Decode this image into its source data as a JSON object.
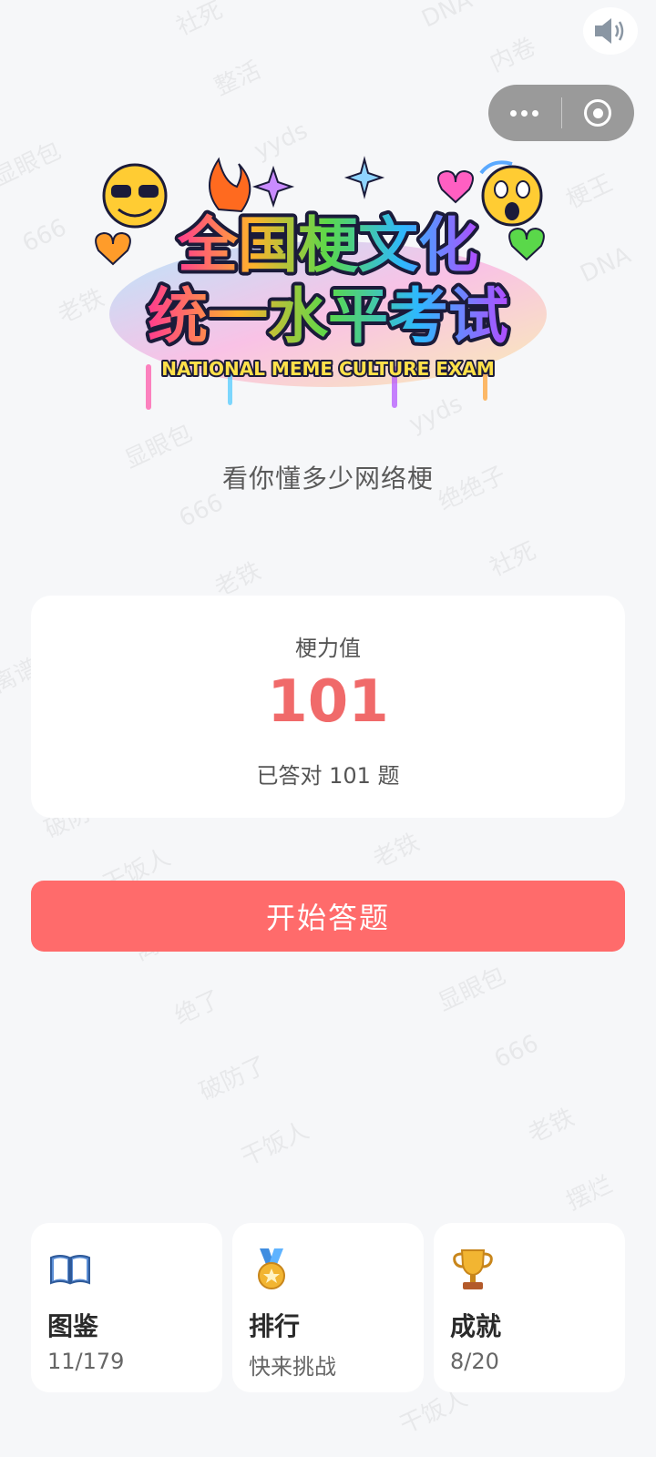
{
  "logo": {
    "line1": "全国梗文化",
    "line2": "统一水平考试",
    "line3": "NATIONAL MEME CULTURE EXAM"
  },
  "subtitle": "看你懂多少网络梗",
  "score": {
    "label": "梗力值",
    "value": "101",
    "answered": "已答对 101 题"
  },
  "start_button": "开始答题",
  "cards": [
    {
      "title": "图鉴",
      "sub": "11/179",
      "icon": "book-icon"
    },
    {
      "title": "排行",
      "sub": "快来挑战",
      "icon": "medal-icon"
    },
    {
      "title": "成就",
      "sub": "8/20",
      "icon": "trophy-icon"
    }
  ],
  "watermark": [
    "社死",
    "DNA",
    "整活",
    "内卷",
    "yyds",
    "梗王",
    "显眼包",
    "666",
    "老铁",
    "绝绝子",
    "破防了",
    "干饭人",
    "摆烂",
    "绝了",
    "离谱"
  ],
  "colors": {
    "accent": "#ff6b6b",
    "score": "#f06a6a",
    "background": "#f6f7f9"
  }
}
